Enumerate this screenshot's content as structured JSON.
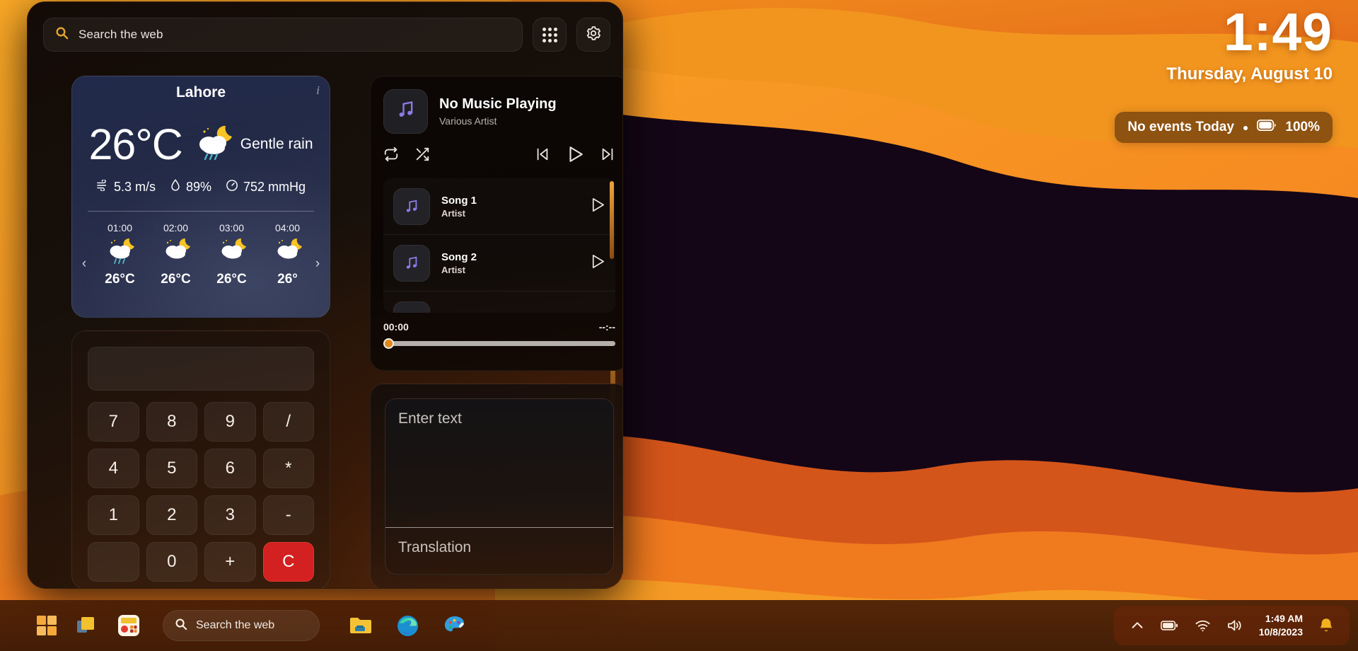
{
  "panel": {
    "search": {
      "placeholder": "Search the web",
      "icon": "search-icon"
    },
    "apps_button_icon": "apps-grid-icon",
    "settings_button_icon": "gear-icon"
  },
  "weather": {
    "city": "Lahore",
    "info_icon": "info-icon",
    "temperature": "26°C",
    "condition": "Gentle rain",
    "condition_icon": "cloud-moon-rain-icon",
    "wind": "5.3 m/s",
    "wind_icon": "wind-icon",
    "humidity": "89%",
    "humidity_icon": "droplet-icon",
    "pressure": "752 mmHg",
    "pressure_icon": "gauge-icon",
    "prev_label": "‹",
    "next_label": "›",
    "hours": [
      {
        "time": "01:00",
        "temp": "26°C",
        "icon": "cloud-moon-rain-icon"
      },
      {
        "time": "02:00",
        "temp": "26°C",
        "icon": "cloud-moon-icon"
      },
      {
        "time": "03:00",
        "temp": "26°C",
        "icon": "cloud-moon-icon"
      },
      {
        "time": "04:00",
        "temp": "26°",
        "icon": "cloud-moon-icon"
      }
    ]
  },
  "calculator": {
    "display_value": "",
    "keys": [
      "7",
      "8",
      "9",
      "/",
      "4",
      "5",
      "6",
      "*",
      "1",
      "2",
      "3",
      "-",
      "",
      "0",
      "+",
      "C"
    ]
  },
  "music": {
    "title": "No Music Playing",
    "artist": "Various Artist",
    "album_art_icon": "music-note-icon",
    "repeat_icon": "repeat-icon",
    "shuffle_icon": "shuffle-icon",
    "prev_icon": "previous-track-icon",
    "play_icon": "play-icon",
    "next_icon": "next-track-icon",
    "elapsed": "00:00",
    "duration": "--:--",
    "songs": [
      {
        "name": "Song 1",
        "artist": "Artist",
        "icon": "music-note-icon",
        "play_icon": "play-icon"
      },
      {
        "name": "Song 2",
        "artist": "Artist",
        "icon": "music-note-icon",
        "play_icon": "play-icon"
      }
    ]
  },
  "translate": {
    "input_placeholder": "Enter text",
    "output_placeholder": "Translation"
  },
  "clock": {
    "time": "1:49",
    "date": "Thursday, August 10"
  },
  "status": {
    "events": "No events Today",
    "separator": "●",
    "battery_icon": "battery-full-icon",
    "battery": "100%"
  },
  "taskbar": {
    "start_icon": "windows-start-icon",
    "taskview_icon": "task-view-icon",
    "widgets_icon": "widgets-icon",
    "search": {
      "placeholder": "Search the web",
      "icon": "search-icon"
    },
    "apps": [
      {
        "name": "file-explorer-icon"
      },
      {
        "name": "edge-browser-icon"
      },
      {
        "name": "paint-icon"
      }
    ],
    "tray": {
      "overflow_icon": "chevron-up-icon",
      "battery_icon": "battery-icon",
      "wifi_icon": "wifi-icon",
      "volume_icon": "volume-icon",
      "time": "1:49 AM",
      "date": "10/8/2023",
      "notification_icon": "bell-icon"
    }
  },
  "colors": {
    "accent_orange": "#e08818",
    "panel_dark": "#140b07",
    "weather_blue": "#222a4b",
    "clear_red": "#d32020"
  }
}
